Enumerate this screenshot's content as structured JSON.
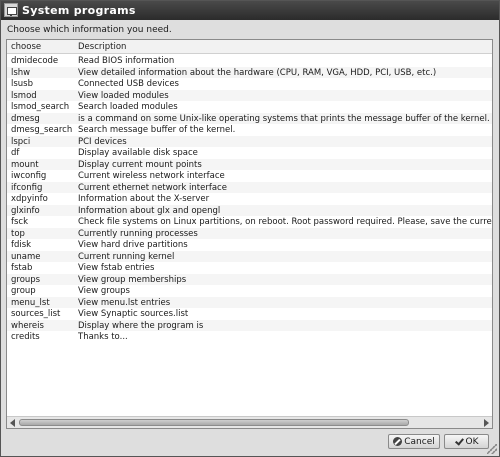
{
  "window": {
    "title": "System programs"
  },
  "prompt": "Choose which information you need.",
  "list": {
    "columns": [
      "choose",
      "Description"
    ],
    "rows": [
      [
        "dmidecode",
        "Read BIOS information"
      ],
      [
        "lshw",
        "View detailed information about the hardware (CPU, RAM, VGA, HDD, PCI, USB, etc.)"
      ],
      [
        "lsusb",
        "Connected USB devices"
      ],
      [
        "lsmod",
        "View loaded modules"
      ],
      [
        "lsmod_search",
        "Search loaded modules"
      ],
      [
        "dmesg",
        "is a command on some Unix-like operating systems that prints the message buffer of the kernel."
      ],
      [
        "dmesg_search",
        "Search message buffer of the kernel."
      ],
      [
        "lspci",
        "PCI devices"
      ],
      [
        "df",
        "Display available disk space"
      ],
      [
        "mount",
        "Display current mount points"
      ],
      [
        "iwconfig",
        "Current wireless network interface"
      ],
      [
        "ifconfig",
        "Current ethernet network interface"
      ],
      [
        "xdpyinfo",
        "Information about the X-server"
      ],
      [
        "glxinfo",
        "Information about glx and opengl"
      ],
      [
        "fsck",
        "Check file systems on Linux partitions, on reboot. Root password required. Please, save the current"
      ],
      [
        "top",
        "Currently running processes"
      ],
      [
        "fdisk",
        "View hard drive partitions"
      ],
      [
        "uname",
        "Current running kernel"
      ],
      [
        "fstab",
        "View fstab entries"
      ],
      [
        "groups",
        "View group memberships"
      ],
      [
        "group",
        "View groups"
      ],
      [
        "menu_lst",
        "View menu.lst entries"
      ],
      [
        "sources_list",
        "View Synaptic sources.list"
      ],
      [
        "whereis",
        "Display where the program is"
      ],
      [
        "credits",
        "Thanks to..."
      ]
    ]
  },
  "buttons": {
    "cancel": "Cancel",
    "ok": "OK"
  },
  "icons": {
    "title": "terminal-icon",
    "cancel": "cancel-icon",
    "ok": "checkmark-icon"
  }
}
